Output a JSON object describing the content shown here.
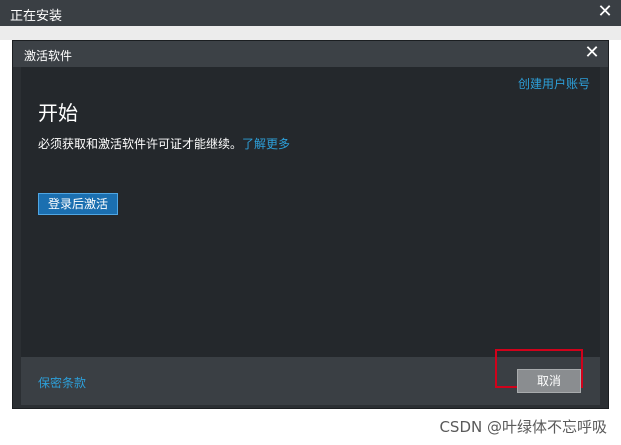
{
  "outer_window": {
    "title": "正在安装",
    "close_glyph": "✕"
  },
  "dialog": {
    "title": "激活软件",
    "close_glyph": "✕",
    "create_account_link": "创建用户账号",
    "heading": "开始",
    "description": "必须获取和激活软件许可证才能继续。",
    "learn_more_link": "了解更多",
    "login_activate_button": "登录后激活",
    "privacy_link": "保密条款",
    "cancel_button": "取消"
  },
  "watermark": "CSDN @叶绿体不忘呼吸",
  "colors": {
    "link": "#2d9fd9",
    "dialog_bg": "#24282c",
    "primary_button": "#1b6fb0",
    "highlight": "#d0021b"
  }
}
